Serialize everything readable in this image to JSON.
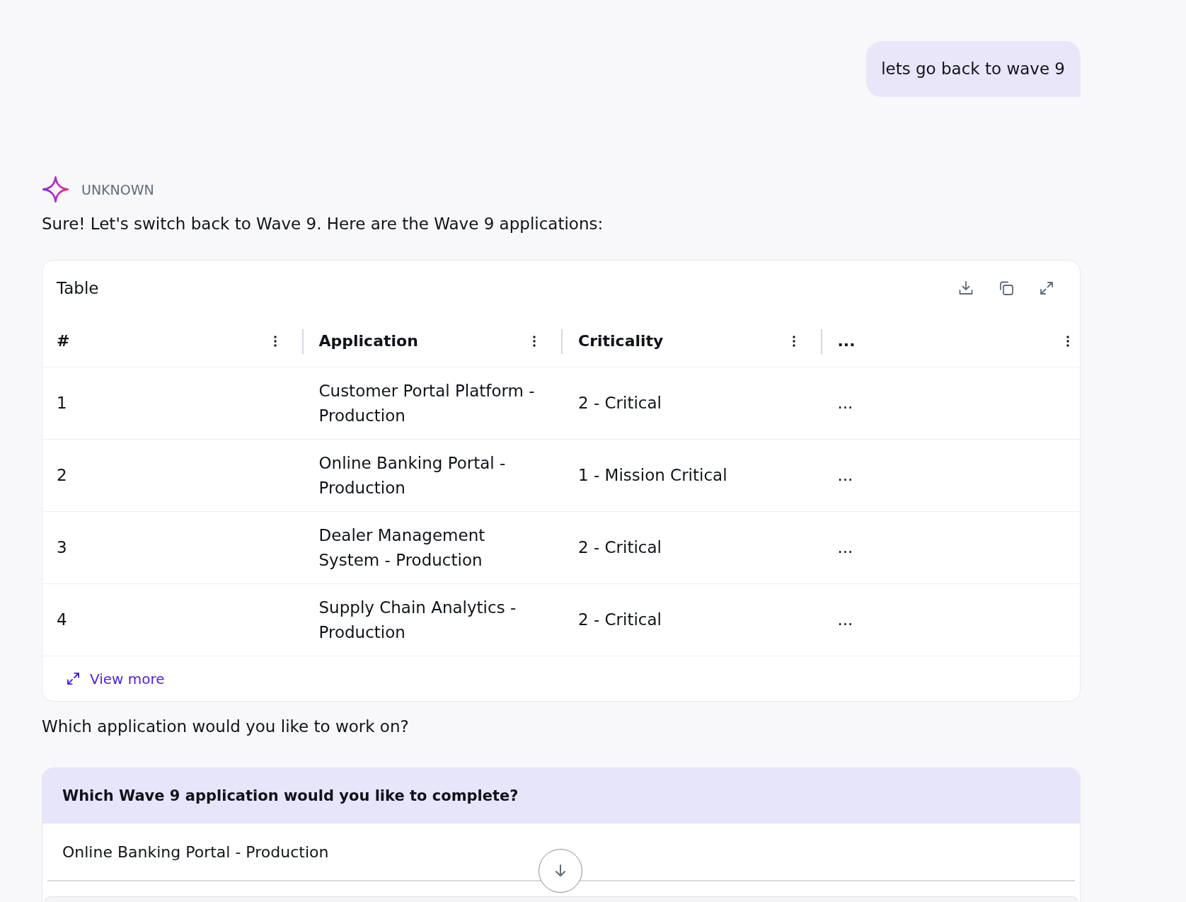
{
  "user_message": {
    "text": "lets go back to wave 9"
  },
  "assistant_message": {
    "name": "UNKNOWN",
    "intro": "Sure! Let's switch back to Wave 9. Here are the Wave 9 applications:",
    "table": {
      "title": "Table",
      "columns": [
        "#",
        "Application",
        "Criticality",
        "..."
      ],
      "rows": [
        [
          "1",
          "Customer Portal Platform - Production",
          "2 - Critical",
          "..."
        ],
        [
          "2",
          "Online Banking Portal - Production",
          "1 - Mission Critical",
          "..."
        ],
        [
          "3",
          "Dealer Management System - Production",
          "2 - Critical",
          "..."
        ],
        [
          "4",
          "Supply Chain Analytics - Production",
          "2 - Critical",
          "..."
        ]
      ],
      "view_more": "View more"
    },
    "follow_up": "Which application would you like to work on?",
    "question": {
      "title": "Which Wave 9 application would you like to complete?",
      "options": [
        {
          "label": "Online Banking Portal - Production"
        }
      ]
    }
  }
}
